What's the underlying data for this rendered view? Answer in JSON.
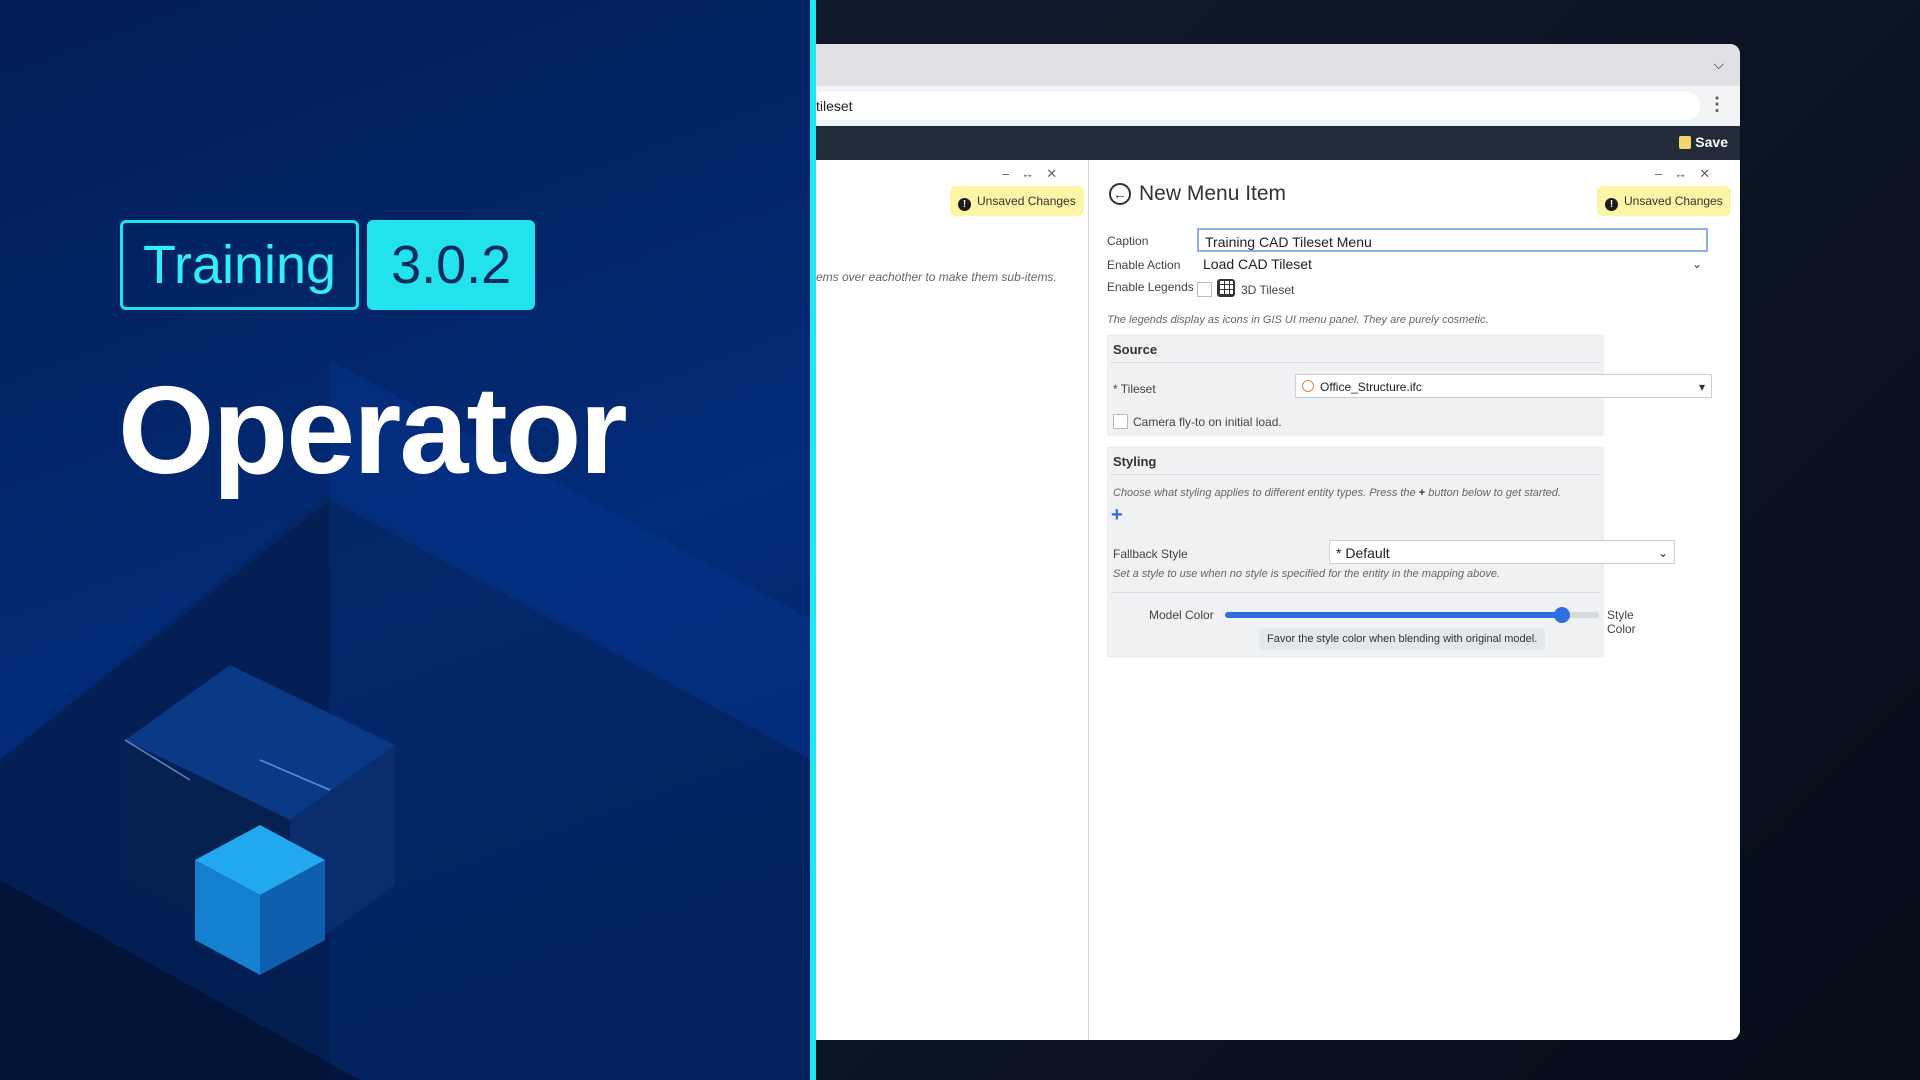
{
  "hero": {
    "badge_training": "Training",
    "badge_version": "3.0.2",
    "title": "Operator",
    "accent_color": "#22e2ee"
  },
  "browser": {
    "tab_chevron_icon": "chevron-down-icon",
    "url_text": "tileset",
    "menu_icon": "kebab-menu-icon",
    "save_label": "Save",
    "save_icon": "save-icon"
  },
  "left_pane": {
    "unsaved_label": "Unsaved Changes",
    "hint": "ems over eachother to make them sub-items."
  },
  "form": {
    "title": "New Menu Item",
    "unsaved_label": "Unsaved Changes",
    "caption_label": "Caption",
    "caption_value": "Training CAD Tileset Menu",
    "enable_action_label": "Enable Action",
    "enable_action_value": "Load CAD Tileset",
    "enable_legends_label": "Enable Legends",
    "legend_option": "3D Tileset",
    "legends_note": "The legends display as icons in GIS UI menu panel. They are purely cosmetic.",
    "source": {
      "title": "Source",
      "tileset_label": "* Tileset",
      "tileset_value": "Office_Structure.ifc",
      "camera_label": "Camera fly-to on initial load."
    },
    "styling": {
      "title": "Styling",
      "note_before": "Choose what styling applies to different entity types. Press the",
      "note_after": "button below to get started.",
      "fallback_label": "Fallback Style",
      "fallback_value": "* Default",
      "fallback_note": "Set a style to use when no style is specified for the entity in the mapping above.",
      "model_color_label": "Model Color",
      "style_color_label": "Style Color",
      "blend_fraction": 0.9,
      "tooltip": "Favor the style color when blending with original model."
    }
  }
}
